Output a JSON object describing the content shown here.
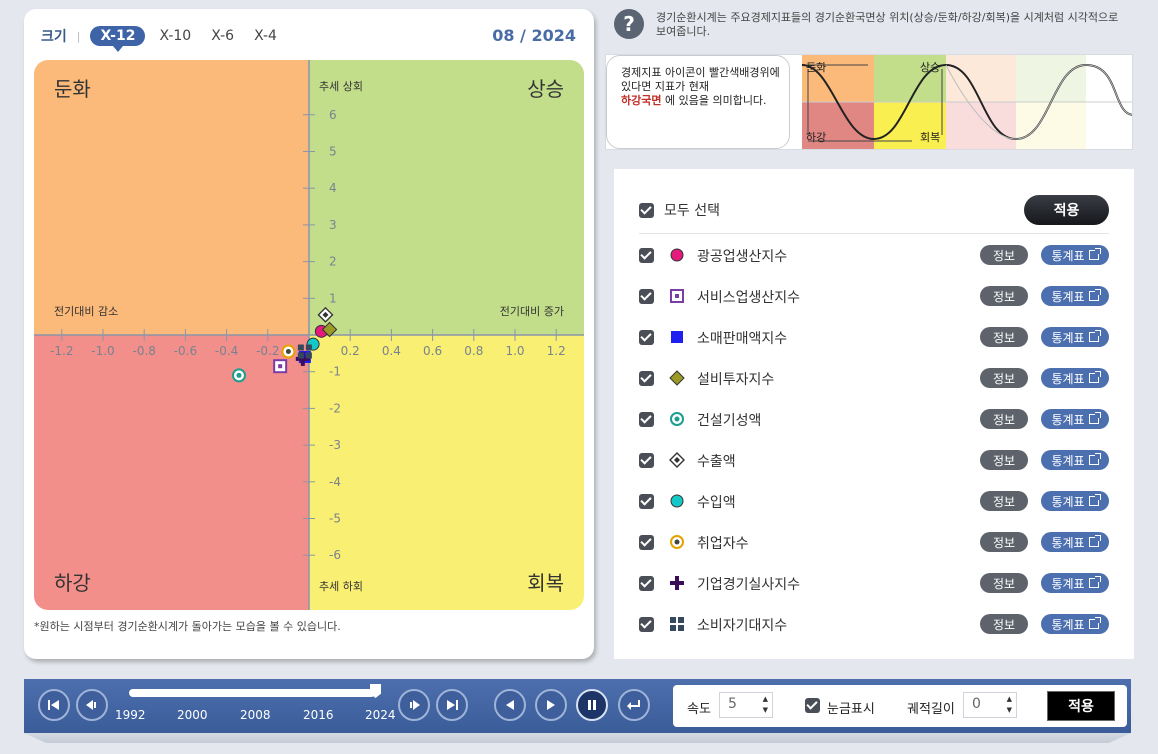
{
  "size_selector": {
    "label": "크기",
    "separator": "|",
    "options": [
      "X-12",
      "X-10",
      "X-6",
      "X-4"
    ],
    "selected": "X-12"
  },
  "date": "08 / 2024",
  "quadrants": {
    "top_left": "둔화",
    "top_right": "상승",
    "bottom_left": "하강",
    "bottom_right": "회복"
  },
  "axis_labels": {
    "trend_up": "추세 상회",
    "trend_down": "추세 하회",
    "prev_decrease": "전기대비 감소",
    "prev_increase": "전기대비 증가"
  },
  "footnote": "*원하는 시점부터 경기순환시계가 돌아가는 모습을 볼 수 있습니다.",
  "help": {
    "icon": "question-icon",
    "text": "경기순환시계는 주요경제지표들의 경기순환국면상 위치(상승/둔화/하강/회복)을 시계처럼 시각적으로 보여줍니다.",
    "bubble_line1": "경제지표 아이콘이 빨간색배경위에 있다면 지표가 현재",
    "bubble_highlight": "하강국면",
    "bubble_line2": "에 있음을 의미합니다.",
    "mini_labels": {
      "top_left": "둔화",
      "top_right": "상승",
      "bottom_left": "하강",
      "bottom_right": "회복"
    }
  },
  "panel": {
    "select_all": "모두 선택",
    "apply": "적용",
    "info_label": "정보",
    "stats_label": "통계표",
    "indicators": [
      {
        "name": "광공업생산지수",
        "icon": "circle-magenta-icon"
      },
      {
        "name": "서비스업생산지수",
        "icon": "square-purple-icon"
      },
      {
        "name": "소매판매액지수",
        "icon": "square-blue-icon"
      },
      {
        "name": "설비투자지수",
        "icon": "diamond-olive-icon"
      },
      {
        "name": "건설기성액",
        "icon": "ring-teal-icon"
      },
      {
        "name": "수출액",
        "icon": "diamond-outline-icon"
      },
      {
        "name": "수입액",
        "icon": "circle-cyan-icon"
      },
      {
        "name": "취업자수",
        "icon": "ring-orange-icon"
      },
      {
        "name": "기업경기실사지수",
        "icon": "cross-purple-icon"
      },
      {
        "name": "소비자기대지수",
        "icon": "grid-dark-icon"
      }
    ]
  },
  "player": {
    "years": [
      "1992",
      "2000",
      "2008",
      "2016",
      "2024"
    ],
    "progress": 1.0,
    "speed_label": "속도",
    "speed_value": "5",
    "grid_label": "눈금표시",
    "trail_label": "궤적길이",
    "trail_value": "0",
    "apply": "적용"
  },
  "colors": {
    "slowdown": "#fbb97a",
    "rise": "#c2de8a",
    "fall": "#f28f8a",
    "recovery": "#f9ef72",
    "accent": "#3e63a6"
  },
  "chart_data": {
    "type": "scatter",
    "xlabel_negative": "전기대비 감소",
    "xlabel_positive": "전기대비 증가",
    "ylabel_positive": "추세 상회",
    "ylabel_negative": "추세 하회",
    "xlim": [
      -1.3,
      1.3
    ],
    "ylim": [
      -6.5,
      6.5
    ],
    "x_ticks": [
      -1.2,
      -1.0,
      -0.8,
      -0.6,
      -0.4,
      -0.2,
      0.2,
      0.4,
      0.6,
      0.8,
      1.0,
      1.2
    ],
    "y_ticks": [
      -6,
      -5,
      -4,
      -3,
      -2,
      -1,
      1,
      2,
      3,
      4,
      5,
      6
    ],
    "quadrants": [
      "둔화",
      "상승",
      "하강",
      "회복"
    ],
    "series": [
      {
        "name": "광공업생산지수",
        "x": 0.06,
        "y": 0.1
      },
      {
        "name": "서비스업생산지수",
        "x": -0.14,
        "y": -0.85
      },
      {
        "name": "소매판매액지수",
        "x": -0.02,
        "y": -0.6
      },
      {
        "name": "설비투자지수",
        "x": 0.1,
        "y": 0.15
      },
      {
        "name": "건설기성액",
        "x": -0.34,
        "y": -1.1
      },
      {
        "name": "수출액",
        "x": 0.08,
        "y": 0.55
      },
      {
        "name": "수입액",
        "x": 0.02,
        "y": -0.25
      },
      {
        "name": "취업자수",
        "x": -0.1,
        "y": -0.45
      },
      {
        "name": "기업경기실사지수",
        "x": -0.03,
        "y": -0.65
      },
      {
        "name": "소비자기대지수",
        "x": -0.02,
        "y": -0.45
      }
    ]
  }
}
